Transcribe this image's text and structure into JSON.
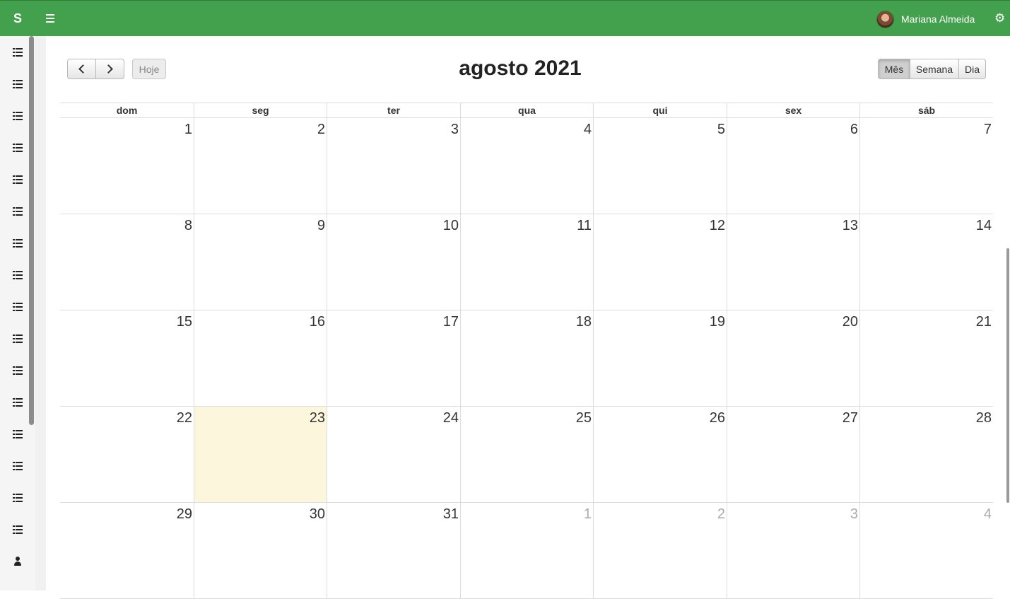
{
  "app": {
    "brand": "S",
    "user_name": "Mariana Almeida",
    "menu_icon": "hamburger-icon",
    "settings_icon": "gears-icon"
  },
  "sidebar": {
    "items": [
      {
        "icon": "list-icon"
      },
      {
        "icon": "list-icon"
      },
      {
        "icon": "list-icon"
      },
      {
        "icon": "list-icon"
      },
      {
        "icon": "list-icon"
      },
      {
        "icon": "list-icon"
      },
      {
        "icon": "list-icon"
      },
      {
        "icon": "list-icon"
      },
      {
        "icon": "list-icon"
      },
      {
        "icon": "list-icon"
      },
      {
        "icon": "list-icon"
      },
      {
        "icon": "list-icon"
      },
      {
        "icon": "list-icon"
      },
      {
        "icon": "list-icon"
      },
      {
        "icon": "list-icon"
      },
      {
        "icon": "list-icon"
      },
      {
        "icon": "user-icon"
      }
    ]
  },
  "toolbar": {
    "prev_icon": "chevron-left-icon",
    "next_icon": "chevron-right-icon",
    "today_label": "Hoje",
    "title": "agosto 2021",
    "views": {
      "month": "Mês",
      "week": "Semana",
      "day": "Dia"
    },
    "active_view": "month"
  },
  "calendar": {
    "weekdays": [
      "dom",
      "seg",
      "ter",
      "qua",
      "qui",
      "sex",
      "sáb"
    ],
    "weeks": [
      [
        {
          "d": "1"
        },
        {
          "d": "2"
        },
        {
          "d": "3"
        },
        {
          "d": "4"
        },
        {
          "d": "5"
        },
        {
          "d": "6"
        },
        {
          "d": "7"
        }
      ],
      [
        {
          "d": "8"
        },
        {
          "d": "9"
        },
        {
          "d": "10"
        },
        {
          "d": "11"
        },
        {
          "d": "12"
        },
        {
          "d": "13"
        },
        {
          "d": "14"
        }
      ],
      [
        {
          "d": "15"
        },
        {
          "d": "16"
        },
        {
          "d": "17"
        },
        {
          "d": "18"
        },
        {
          "d": "19"
        },
        {
          "d": "20"
        },
        {
          "d": "21"
        }
      ],
      [
        {
          "d": "22"
        },
        {
          "d": "23",
          "today": true
        },
        {
          "d": "24"
        },
        {
          "d": "25"
        },
        {
          "d": "26"
        },
        {
          "d": "27"
        },
        {
          "d": "28"
        }
      ],
      [
        {
          "d": "29"
        },
        {
          "d": "30"
        },
        {
          "d": "31"
        },
        {
          "d": "1",
          "other": true
        },
        {
          "d": "2",
          "other": true
        },
        {
          "d": "3",
          "other": true
        },
        {
          "d": "4",
          "other": true
        }
      ]
    ],
    "today_color": "#fbf6dc"
  },
  "colors": {
    "topbar": "#43a04c",
    "grid_border": "#dddddd"
  }
}
